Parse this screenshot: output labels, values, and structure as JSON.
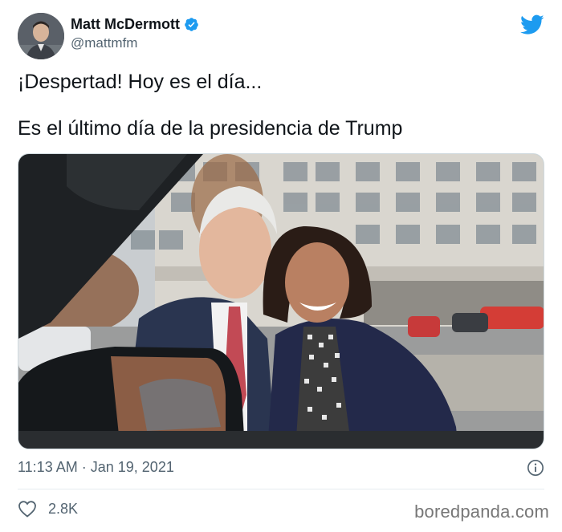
{
  "user": {
    "name": "Matt McDermott",
    "handle": "@mattmfm"
  },
  "tweet": {
    "line1": "¡Despertad! Hoy es el día...",
    "line2": "Es el último día de la presidencia de Trump"
  },
  "meta": {
    "time": "11:13 AM",
    "separator": "·",
    "date": "Jan 19, 2021"
  },
  "likes": {
    "count": "2.8K"
  },
  "watermark": "boredpanda.com",
  "colors": {
    "verified": "#1d9bf0",
    "twitter_bird": "#1d9bf0",
    "secondary_text": "#536471"
  },
  "icons": [
    "verified-badge-icon",
    "twitter-bird-icon",
    "info-icon",
    "heart-icon"
  ]
}
